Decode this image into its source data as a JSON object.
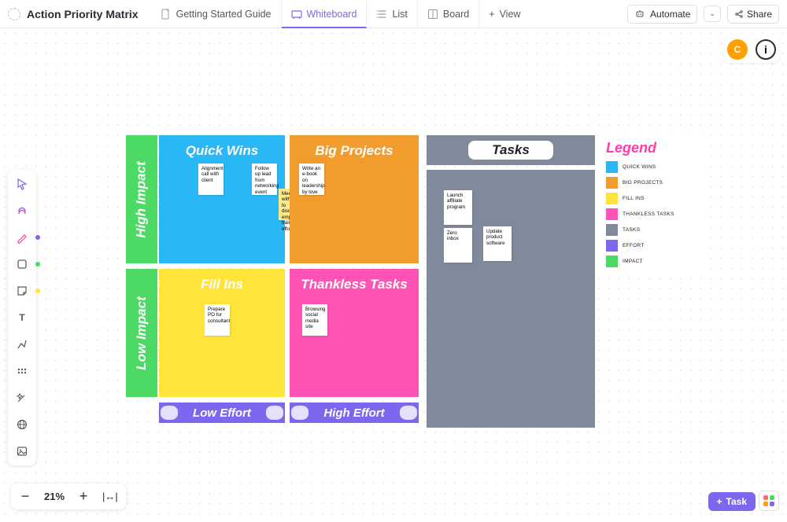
{
  "header": {
    "title": "Action Priority Matrix",
    "tabs": [
      {
        "label": "Getting Started Guide",
        "icon": "doc-icon"
      },
      {
        "label": "Whiteboard",
        "icon": "whiteboard-icon",
        "active": true
      },
      {
        "label": "List",
        "icon": "list-icon"
      },
      {
        "label": "Board",
        "icon": "board-icon"
      }
    ],
    "add_view_label": "View",
    "automate_label": "Automate",
    "share_label": "Share"
  },
  "avatar_letter": "C",
  "zoom": {
    "value": "21%"
  },
  "task_button": "Task",
  "matrix": {
    "rows": [
      "High Impact",
      "Low Impact"
    ],
    "cols": [
      "Low Effort",
      "High Effort"
    ],
    "quadrants": {
      "quick_wins": {
        "title": "Quick Wins",
        "color": "#2ab7f5"
      },
      "big_projects": {
        "title": "Big Projects",
        "color": "#f39c2e"
      },
      "fill_ins": {
        "title": "Fill Ins",
        "color": "#ffe43a"
      },
      "thankless_tasks": {
        "title": "Thankless Tasks",
        "color": "#ff54b5"
      }
    },
    "tasks_panel_title": "Tasks"
  },
  "stickies": {
    "quick_wins": [
      {
        "text": "Alignment call with client",
        "bg": "#fff"
      },
      {
        "text": "Follow up lead from networking event",
        "bg": "#fff"
      },
      {
        "text": "Meet up with HR to discuss employee training efforts",
        "bg": "#ffe88a"
      }
    ],
    "big_projects": [
      {
        "text": "Write an e-book on leadership by love",
        "bg": "#fff"
      }
    ],
    "fill_ins": [
      {
        "text": "Prepare PO for consultant",
        "bg": "#fff"
      }
    ],
    "thankless_tasks": [
      {
        "text": "Browsing social media site",
        "bg": "#fff"
      }
    ],
    "tasks": [
      {
        "text": "Launch affiliate program",
        "bg": "#fff"
      },
      {
        "text": "Zero inbox",
        "bg": "#fff"
      },
      {
        "text": "Update product software",
        "bg": "#fff"
      }
    ]
  },
  "legend": {
    "title": "Legend",
    "items": [
      {
        "label": "QUICK WINS",
        "color": "#2ab7f5"
      },
      {
        "label": "BIG PROJECTS",
        "color": "#f39c2e"
      },
      {
        "label": "FILL INS",
        "color": "#ffe43a"
      },
      {
        "label": "THANKLESS TASKS",
        "color": "#ff54b5"
      },
      {
        "label": "TASKS",
        "color": "#808a9a"
      },
      {
        "label": "EFFORT",
        "color": "#7b68ee"
      },
      {
        "label": "IMPACT",
        "color": "#4cd964"
      }
    ]
  },
  "toolbox": {
    "tools": [
      "select",
      "ai",
      "pen",
      "shape",
      "sticky",
      "text",
      "connector",
      "more",
      "magic",
      "web",
      "image"
    ]
  }
}
